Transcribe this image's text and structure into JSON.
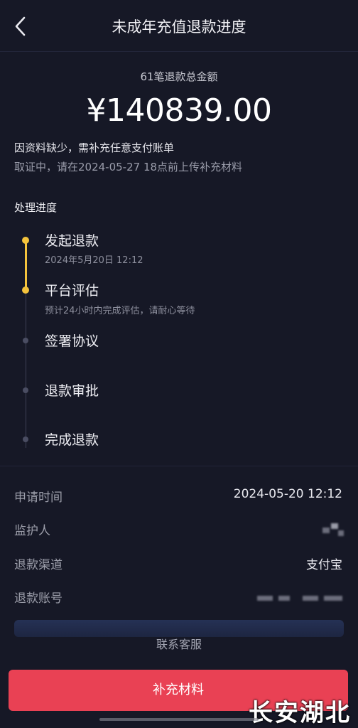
{
  "header": {
    "title": "未成年充值退款进度"
  },
  "summary": {
    "count_label": "61笔退款总金额",
    "amount": "¥140839.00",
    "notice_line1": "因资料缺少，需补充任意支付账单",
    "notice_line2": "取证中，请在2024-05-27 18点前上传补充材料"
  },
  "progress": {
    "section_title": "处理进度",
    "steps": [
      {
        "title": "发起退款",
        "subtitle": "2024年5月20日 12:12",
        "status": "done"
      },
      {
        "title": "平台评估",
        "subtitle": "预计24小时内完成评估，请耐心等待",
        "status": "current"
      },
      {
        "title": "签署协议",
        "status": "pending"
      },
      {
        "title": "退款审批",
        "status": "pending"
      },
      {
        "title": "完成退款",
        "status": "pending"
      }
    ]
  },
  "info": {
    "rows": [
      {
        "label": "申请时间",
        "value": "2024-05-20 12:12"
      },
      {
        "label": "监护人",
        "value": ""
      },
      {
        "label": "退款渠道",
        "value": "支付宝"
      },
      {
        "label": "退款账号",
        "value": ""
      }
    ]
  },
  "actions": {
    "customer_service": "联系客服",
    "submit_label": "补充材料"
  },
  "watermark": "长安湖北",
  "colors": {
    "background": "#161826",
    "accent_progress": "#f4c33c",
    "primary_button": "#e94154"
  }
}
